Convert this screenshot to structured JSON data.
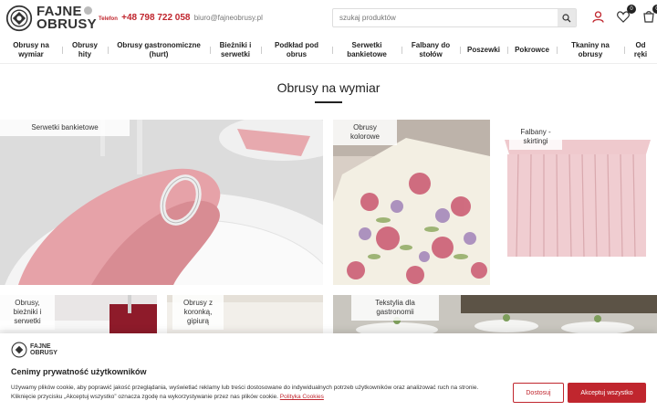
{
  "header": {
    "logo_line1": "FAJNE",
    "logo_line2": "OBRUSY",
    "phone_label": "Telefon",
    "phone": "+48 798 722 058",
    "email": "biuro@fajneobrusy.pl",
    "search_placeholder": "szukaj produktów",
    "wishlist_count": "0",
    "cart_count": "0"
  },
  "nav": [
    "Obrusy na wymiar",
    "Obrusy hity",
    "Obrusy gastronomiczne (hurt)",
    "Bieżniki i serwetki",
    "Podkład pod obrus",
    "Serwetki bankietowe",
    "Falbany do stołów",
    "Poszewki",
    "Pokrowce",
    "Tkaniny na obrusy",
    "Od ręki"
  ],
  "page_title": "Obrusy na wymiar",
  "tiles": [
    "Serwetki bankietowe",
    "Obrusy kolorowe",
    "Falbany - skirtingi",
    "Obrusy, bieżniki i serwetki",
    "Obrusy z koronką, gipiurą",
    "Tekstylia dla gastronomii"
  ],
  "cookie": {
    "logo_line1": "FAJNE",
    "logo_line2": "OBRUSY",
    "title": "Cenimy prywatność użytkowników",
    "text": "Używamy plików cookie, aby poprawić jakość przeglądania, wyświetlać reklamy lub treści dostosowane do indywidualnych potrzeb użytkowników oraz analizować ruch na stronie. Kliknięcie przycisku „Akceptuj wszystko” oznacza zgodę na wykorzystywanie przez nas plików cookie.",
    "link": "Polityka Cookies",
    "reject": "Dostosuj",
    "accept": "Akceptuj wszystko"
  },
  "colors": {
    "accent": "#c0262e",
    "pink": "#e8a3a9"
  }
}
